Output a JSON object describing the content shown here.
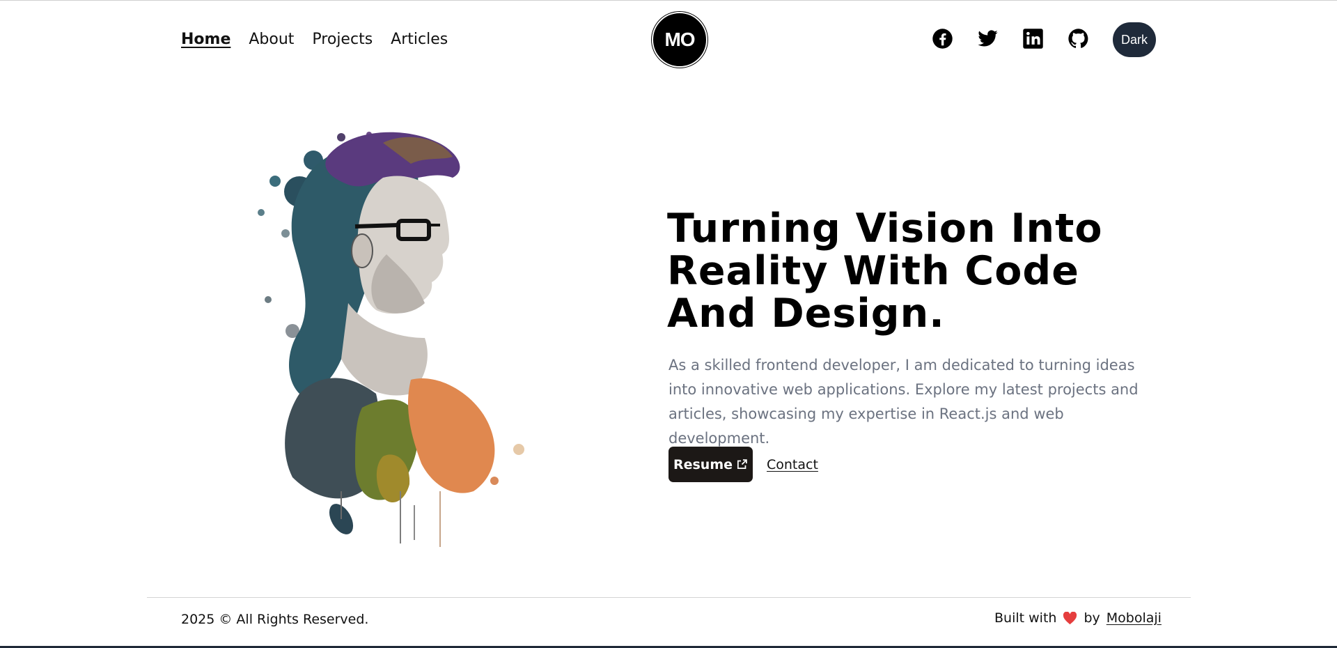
{
  "nav": {
    "links": [
      "Home",
      "About",
      "Projects",
      "Articles"
    ],
    "active": "Home"
  },
  "logo": {
    "text": "MO"
  },
  "socials": [
    "facebook-icon",
    "twitter-icon",
    "linkedin-icon",
    "github-icon"
  ],
  "mode_toggle": {
    "label": "Dark"
  },
  "hero": {
    "headline": "Turning Vision Into Reality With Code And Design.",
    "intro": "As a skilled frontend developer, I am dedicated to turning ideas into innovative web applications. Explore my latest projects and articles, showcasing my expertise in React.js and web development.",
    "resume_label": "Resume",
    "contact_label": "Contact"
  },
  "footer": {
    "copyright": "2025 © All Rights Reserved.",
    "built_with": "Built with",
    "by": "by",
    "author": "Mobolaji"
  },
  "colors": {
    "text": "#111111",
    "muted": "#6b7280",
    "dark_button": "#1c1816",
    "toggle": "#1f2a3a",
    "heart": "#e53e3e"
  }
}
